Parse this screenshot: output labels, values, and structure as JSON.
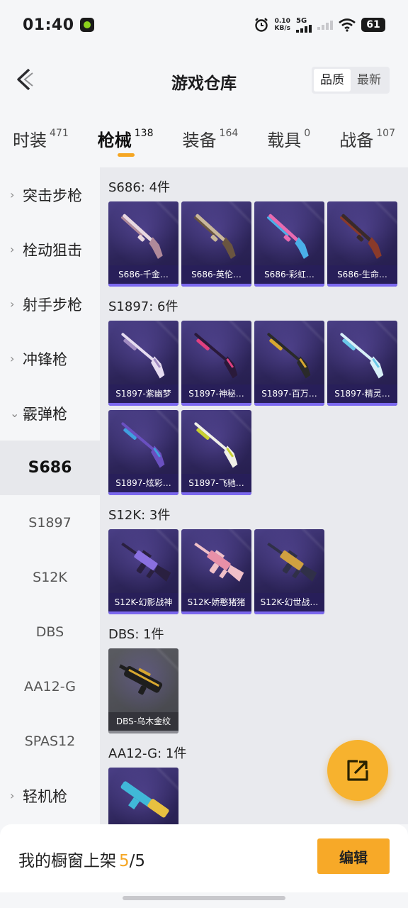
{
  "status": {
    "time": "01:40",
    "net_speed_value": "0.10",
    "net_speed_unit": "KB/s",
    "signal": "5G",
    "battery": "61"
  },
  "header": {
    "title": "游戏仓库",
    "sort": [
      "品质",
      "最新"
    ],
    "sort_active": 0
  },
  "tabs": [
    {
      "label": "时装",
      "count": "471",
      "active": false
    },
    {
      "label": "枪械",
      "count": "138",
      "active": true
    },
    {
      "label": "装备",
      "count": "164",
      "active": false
    },
    {
      "label": "载具",
      "count": "0",
      "active": false
    },
    {
      "label": "战备",
      "count": "107",
      "active": false
    }
  ],
  "sidebar": [
    {
      "type": "parent",
      "label": "突击步枪",
      "expanded": false
    },
    {
      "type": "parent",
      "label": "栓动狙击",
      "expanded": false
    },
    {
      "type": "parent",
      "label": "射手步枪",
      "expanded": false
    },
    {
      "type": "parent",
      "label": "冲锋枪",
      "expanded": false
    },
    {
      "type": "parent",
      "label": "霰弹枪",
      "expanded": true
    },
    {
      "type": "child",
      "label": "S686",
      "selected": true
    },
    {
      "type": "child",
      "label": "S1897",
      "selected": false
    },
    {
      "type": "child",
      "label": "S12K",
      "selected": false
    },
    {
      "type": "child",
      "label": "DBS",
      "selected": false
    },
    {
      "type": "child",
      "label": "AA12-G",
      "selected": false
    },
    {
      "type": "child",
      "label": "SPAS12",
      "selected": false
    },
    {
      "type": "parent",
      "label": "轻机枪",
      "expanded": false
    }
  ],
  "groups": [
    {
      "title": "S686: 4件",
      "kind": "shotgun",
      "items": [
        {
          "name": "S686-千金…",
          "c1": "#e8d8e0",
          "c2": "#b08a9a"
        },
        {
          "name": "S686-英伦…",
          "c1": "#c9b79a",
          "c2": "#6a5540"
        },
        {
          "name": "S686-彩虹…",
          "c1": "#e86ab0",
          "c2": "#4ab0e8"
        },
        {
          "name": "S686-生命…",
          "c1": "#3a2a2a",
          "c2": "#8a3a2a"
        }
      ]
    },
    {
      "title": "S1897: 6件",
      "kind": "pump",
      "items": [
        {
          "name": "S1897-紫幽梦",
          "c1": "#e6dcf0",
          "c2": "#a08ac0"
        },
        {
          "name": "S1897-神秘…",
          "c1": "#2a1a3a",
          "c2": "#e04080"
        },
        {
          "name": "S1897-百万…",
          "c1": "#2a2a2a",
          "c2": "#d8a830"
        },
        {
          "name": "S1897-精灵…",
          "c1": "#d8f0f8",
          "c2": "#6ac8e8"
        },
        {
          "name": "S1897-炫彩…",
          "c1": "#6a50c0",
          "c2": "#40a0e0"
        },
        {
          "name": "S1897-飞驰…",
          "c1": "#f0f0e8",
          "c2": "#c8d030"
        }
      ]
    },
    {
      "title": "S12K: 3件",
      "kind": "rifle",
      "items": [
        {
          "name": "S12K-幻影战神",
          "c1": "#2a2040",
          "c2": "#8a70e0"
        },
        {
          "name": "S12K-娇憨猪猪",
          "c1": "#f0c0c8",
          "c2": "#e890a8"
        },
        {
          "name": "S12K-幻世战…",
          "c1": "#303048",
          "c2": "#d0a040"
        }
      ]
    },
    {
      "title": "DBS: 1件",
      "kind": "bullpup",
      "gray": true,
      "items": [
        {
          "name": "DBS-乌木金纹",
          "c1": "#1e1e1e",
          "c2": "#d8a830"
        }
      ]
    },
    {
      "title": "AA12-G: 1件",
      "kind": "aa12",
      "items": [
        {
          "name": "",
          "c1": "#40b8d8",
          "c2": "#e8c040"
        }
      ]
    }
  ],
  "bottom": {
    "showcase_label": "我的橱窗上架",
    "current": "5",
    "separator": "/",
    "total": "5",
    "edit_label": "编辑"
  },
  "colors": {
    "accent": "#f5a623",
    "card_bg": "#2c2458",
    "rarity_purple": "#7b68ee"
  },
  "icons": {
    "back": "back-arrow-icon",
    "share": "share-out-icon",
    "alarm": "alarm-icon",
    "wifi": "wifi-icon"
  }
}
